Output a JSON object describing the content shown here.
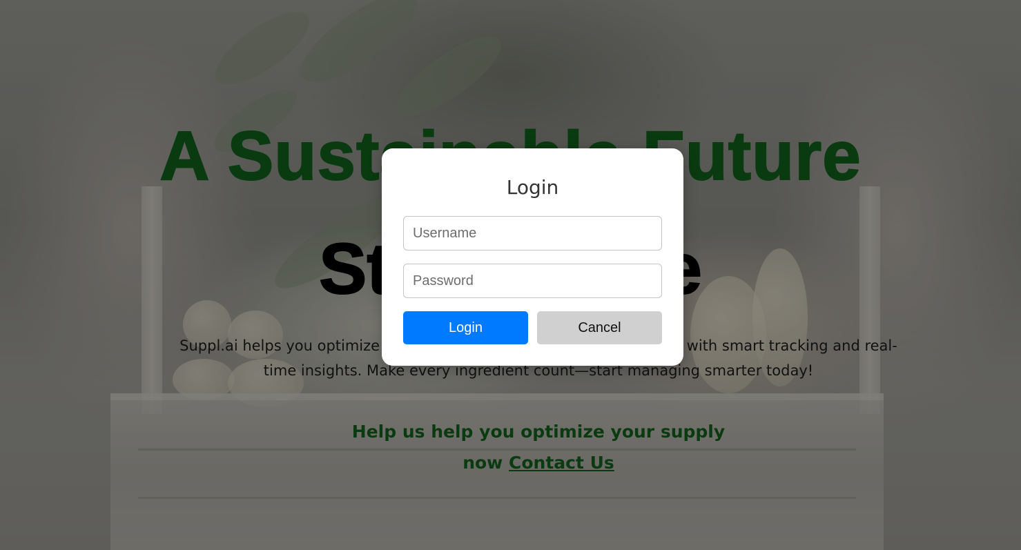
{
  "hero": {
    "headline_line1": "A Sustainable Future",
    "headline_line2": "Starts Here",
    "description": "Suppl.ai helps you optimize your supply and reduce food waste costs with smart tracking and real-time insights. Make every ingredient count—start managing smarter today!",
    "cta_text": "Help us help you optimize your supply now",
    "cta_link": "Contact Us"
  },
  "modal": {
    "title": "Login",
    "username_placeholder": "Username",
    "username_value": "",
    "password_placeholder": "Password",
    "password_value": "",
    "login_label": "Login",
    "cancel_label": "Cancel"
  },
  "colors": {
    "headline_green": "#0a3a10",
    "primary_button": "#007bff",
    "cancel_button": "#d0d0d0"
  }
}
